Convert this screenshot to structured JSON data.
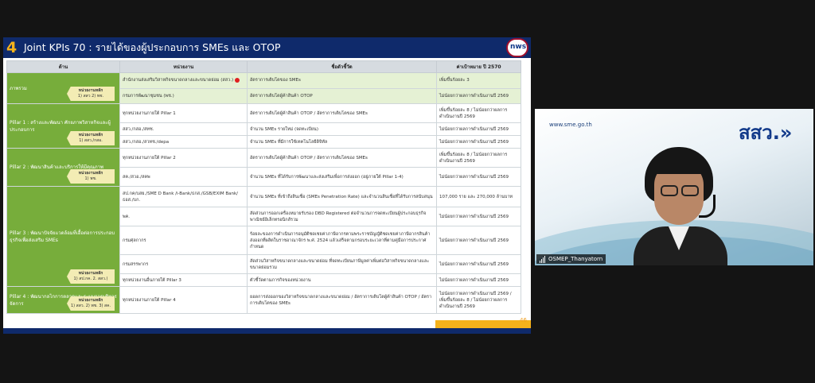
{
  "slide": {
    "number": "4",
    "title": "Joint KPIs 70 : รายได้ของผู้ประกอบการ SMEs และ OTOP",
    "logo_text": "nws",
    "page_number": "46",
    "headers": [
      "ด้าน",
      "หน่วยงาน",
      "ชื่อตัวชี้วัด",
      "ค่าเป้าหมาย ปี 2570"
    ],
    "pillars": [
      {
        "title": "ภาพรวม",
        "tag_label": "หน่วยงานหลัก",
        "tag_value": "1) สสว 2) พช."
      },
      {
        "title": "Pillar 1 : สร้างและพัฒนา ศักยภาพวิสาหกิจและผู้ประกอบการ",
        "tag_label": "หน่วยงานหลัก",
        "tag_value": "1) สสว./กสอ."
      },
      {
        "title": "Pillar 2 : พัฒนาสินค้าและบริการให้มีคุณภาพ",
        "tag_label": "หน่วยงานหลัก",
        "tag_value": "1) พช."
      },
      {
        "title": "Pillar 3 : พัฒนาปัจจัยแวดล้อมที่เอื้อต่อการประกอบธุรกิจเพื่อส่งเสริม SMEs",
        "tag_label": "หน่วยงานหลัก",
        "tag_value": "1) สป.กค. 2. สสว.)"
      },
      {
        "title": "Pillar 4 : พัฒนากลไกการตลาดและระบบการบริหารจัดการ",
        "tag_label": "หน่วยงานหลัก",
        "tag_value": "1) สสว. 2) พช. 3) สค."
      }
    ],
    "rows": [
      {
        "agency": "สำนักงานส่งเสริมวิสาหกิจขนาดกลางและขนาดย่อม (สสว.)",
        "kpi": "อัตราการเติบโตของ SMEs",
        "target": "เพิ่มขึ้นร้อยละ 3"
      },
      {
        "agency": "กรมการพัฒนาชุมชน (พช.)",
        "kpi": "อัตราการเติบโตผู้ค้าสินค้า OTOP",
        "target": "ไม่น้อยกว่าผลการดำเนินงานปี 2569"
      },
      {
        "agency": "ทุกหน่วยงานภายใต้ Pillar 1",
        "kpi": "อัตราการเติบโตผู้ค้าสินค้า OTOP / อัตราการเติบโตของ SMEs",
        "target": "เพิ่มขึ้นร้อยละ 8 / ไม่น้อยกว่าผลการดำเนินงานปี 2569"
      },
      {
        "agency": "สสว./กสอ./สทช.",
        "kpi": "จำนวน SMEs รายใหม่ (จดทะเบียน)",
        "target": "ไม่น้อยกว่าผลการดำเนินงานปี 2569"
      },
      {
        "agency": "สสว./กสอ./สวทช./depa",
        "kpi": "จำนวน SMEs ที่มีการใช้เทคโนโลยีดิจิทัล",
        "target": "ไม่น้อยกว่าผลการดำเนินงานปี 2569"
      },
      {
        "agency": "ทุกหน่วยงานภายใต้ Pillar 2",
        "kpi": "อัตราการเติบโตผู้ค้าสินค้า OTOP / อัตราการเติบโตของ SMEs",
        "target": "เพิ่มขึ้นร้อยละ 8 / ไม่น้อยกว่าผลการดำเนินงานปี 2569"
      },
      {
        "agency": "สค./สวอ./สคพ",
        "kpi": "จำนวน SMEs ที่ได้รับการพัฒนาและส่งเสริมเพื่อการส่งออก (อยู่ภายใต้ Pillar 1-4)",
        "target": "ไม่น้อยกว่าผลการดำเนินงานปี 2569"
      },
      {
        "agency": "สป.กค/บสย./SME D Bank /i-Bank/ธกส./GSB/EXIM Bank/ธอส./บก.",
        "kpi": "จำนวน SMEs ที่เข้าถึงสินเชื่อ (SMEs Penetration Rate) และจำนวนสินเชื่อที่ได้รับการสนับสนุน",
        "target": "107,000 ราย และ 270,000 ล้านบาท"
      },
      {
        "agency": "พค.",
        "kpi": "สัดส่วนการออกเครื่องหมายรับรอง DBD Registered ต่อจำนวนการจดทะเบียนผู้ประกอบธุรกิจพาณิชย์อิเล็กทรอนิกส์รวม",
        "target": "ไม่น้อยกว่าผลการดำเนินงานปี 2569"
      },
      {
        "agency": "กรมศุลกากร",
        "kpi": "ร้อยละของการดำเนินการอนุมัติชดเชยค่าภาษีอากรตามพระราชบัญญัติชดเชยค่าภาษีอากรสินค้าส่งออกที่ผลิตในราชอาณาจักร พ.ศ. 2524 แล้วเสร็จตามกรอบระยะเวลาที่ตามคู่มือการประกาศกำหนด",
        "target": "ไม่น้อยกว่าผลการดำเนินงานปี 2569"
      },
      {
        "agency": "กรมสรรพากร",
        "kpi": "สัดส่วนวิสาหกิจขนาดกลางและขนาดย่อม ที่จดทะเบียนภาษีมูลค่าเพิ่มต่อวิสาหกิจขนาดกลางและขนาดย่อมรวม",
        "target": "ไม่น้อยกว่าผลการดำเนินงานปี 2569"
      },
      {
        "agency": "ทุกหน่วยงานอื่นภายใต้ Pillar 3",
        "kpi": "ตัวชี้วัดตามภารกิจของหน่วยงาน",
        "target": "ไม่น้อยกว่าผลการดำเนินงานปี 2569"
      },
      {
        "agency": "ทุกหน่วยงานภายใต้ Pillar 4",
        "kpi": "ยอดการส่งออกของวิสาหกิจขนาดกลางและขนาดย่อม / อัตราการเติบโตผู้ค้าสินค้า OTOP / อัตราการเติบโตของ SMEs",
        "target": "ไม่น้อยกว่าผลการดำเนินงานปี 2569 / เพิ่มขึ้นร้อยละ 8 / ไม่น้อยกว่าผลการดำเนินงานปี 2569"
      }
    ]
  },
  "video": {
    "site": "www.sme.go.th",
    "brand": "สสว.»",
    "participant_name": "OSMEP_Thanyatorn"
  },
  "colors": {
    "pillar_green": "#77ad3b",
    "header_navy": "#0f2a6b",
    "accent_orange": "#f5b21b"
  }
}
